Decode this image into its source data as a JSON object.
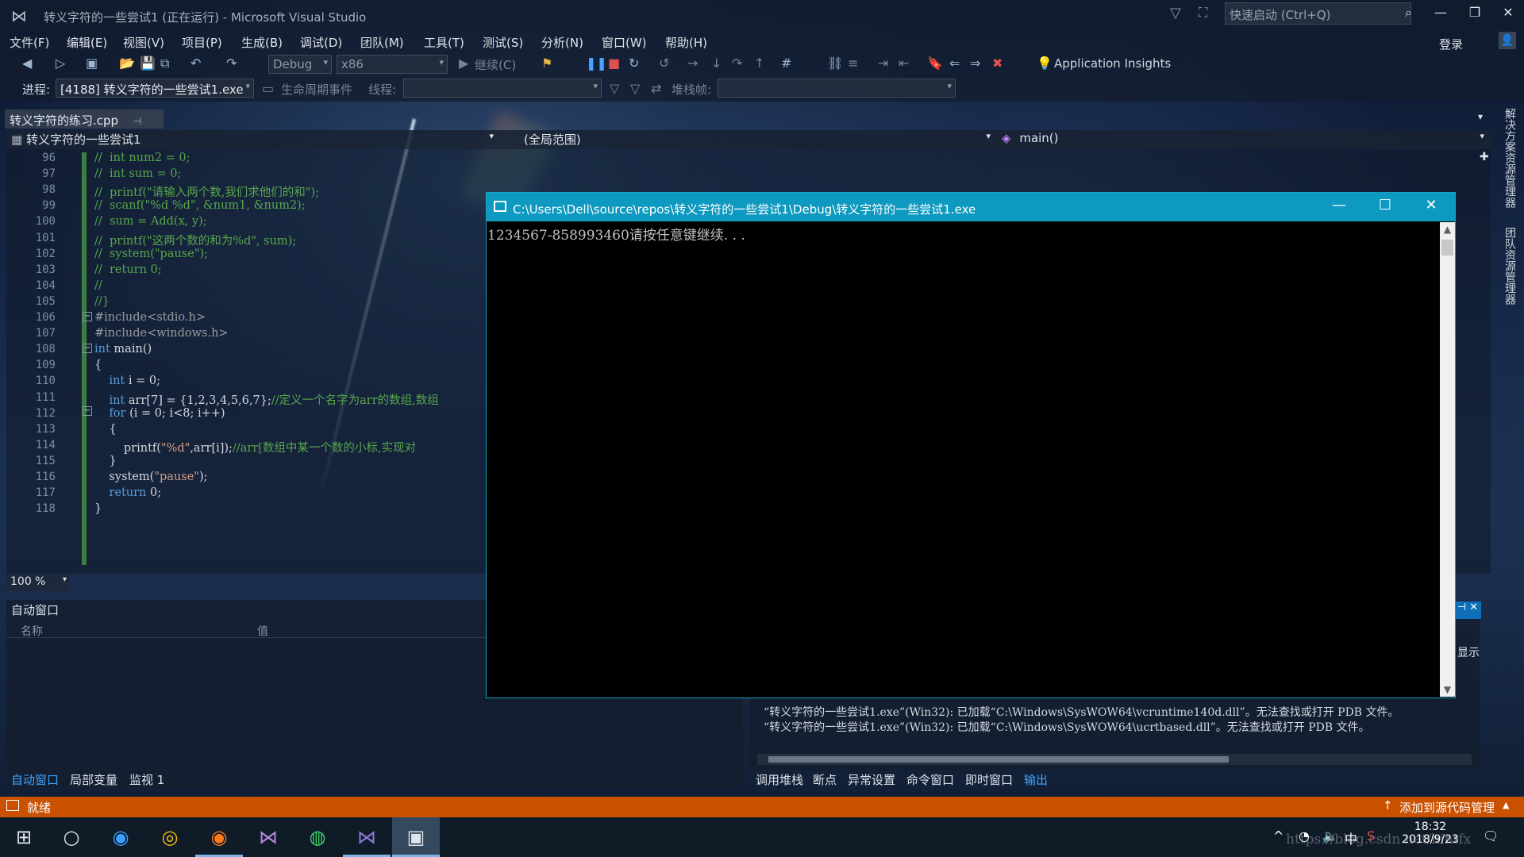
{
  "window": {
    "title": "转义字符的一些尝试1 (正在运行) - Microsoft Visual Studio",
    "quick_launch_placeholder": "快速启动 (Ctrl+Q)",
    "login": "登录"
  },
  "menu": [
    "文件(F)",
    "编辑(E)",
    "视图(V)",
    "项目(P)",
    "生成(B)",
    "调试(D)",
    "团队(M)",
    "工具(T)",
    "测试(S)",
    "分析(N)",
    "窗口(W)",
    "帮助(H)"
  ],
  "toolbar": {
    "config": "Debug",
    "platform": "x86",
    "continue_label": "继续(C)",
    "app_insights": "Application Insights"
  },
  "debug_bar": {
    "process_label": "进程:",
    "process_value": "[4188] 转义字符的一些尝试1.exe",
    "lifecycle_label": "生命周期事件",
    "thread_label": "线程:",
    "stack_label": "堆栈帧:"
  },
  "editor": {
    "tab_name": "转义字符的练习.cpp",
    "project_scope": "转义字符的一些尝试1",
    "global_scope": "(全局范围)",
    "function_scope": "main()",
    "zoom": "100 %",
    "lines": [
      {
        "n": "96",
        "text": "//  int num2 = 0;"
      },
      {
        "n": "97",
        "text": "//  int sum = 0;"
      },
      {
        "n": "98",
        "text": "//  printf(\"请输入两个数,我们求他们的和\");"
      },
      {
        "n": "99",
        "text": "//  scanf(\"%d %d\", &num1, &num2);"
      },
      {
        "n": "100",
        "text": "//  sum = Add(x, y);"
      },
      {
        "n": "101",
        "text": "//  printf(\"这两个数的和为%d\", sum);"
      },
      {
        "n": "102",
        "text": "//  system(\"pause\");"
      },
      {
        "n": "103",
        "text": "//  return 0;"
      },
      {
        "n": "104",
        "text": "//"
      },
      {
        "n": "105",
        "text": "//}"
      },
      {
        "n": "106",
        "text": "#include<stdio.h>"
      },
      {
        "n": "107",
        "text": "#include<windows.h>"
      },
      {
        "n": "108",
        "text": "int main()"
      },
      {
        "n": "109",
        "text": "{"
      },
      {
        "n": "110",
        "text": "    int i = 0;"
      },
      {
        "n": "111",
        "text": "    int arr[7] = {1,2,3,4,5,6,7};//定义一个名字为arr的数组,数组"
      },
      {
        "n": "112",
        "text": "    for (i = 0; i<8; i++)"
      },
      {
        "n": "113",
        "text": "    {"
      },
      {
        "n": "114",
        "text": "        printf(\"%d\",arr[i]);//arr[数组中某一个数的小标,实现对"
      },
      {
        "n": "115",
        "text": "    }"
      },
      {
        "n": "116",
        "text": "    system(\"pause\");"
      },
      {
        "n": "117",
        "text": "    return 0;"
      },
      {
        "n": "118",
        "text": "}"
      }
    ]
  },
  "console": {
    "title": "C:\\Users\\Dell\\source\\repos\\转义字符的一些尝试1\\Debug\\转义字符的一些尝试1.exe",
    "output": "1234567-858993460请按任意键继续. . ."
  },
  "autos": {
    "title": "自动窗口",
    "col_name": "名称",
    "col_value": "值",
    "tabs": [
      "自动窗口",
      "局部变量",
      "监视 1"
    ]
  },
  "output": {
    "partial_label": "显示",
    "lines": [
      "“转义字符的一些尝试1.exe”(Win32): 已加载“C:\\Windows\\SysWOW64\\vcruntime140d.dll”。无法查找或打开 PDB 文件。",
      "“转义字符的一些尝试1.exe”(Win32): 已加载“C:\\Windows\\SysWOW64\\ucrtbased.dll”。无法查找或打开 PDB 文件。"
    ],
    "tabs": [
      "调用堆栈",
      "断点",
      "异常设置",
      "命令窗口",
      "即时窗口",
      "输出"
    ]
  },
  "side_panels": [
    "解决方案资源管理器",
    "团队资源管理器"
  ],
  "status": {
    "left": "就绪",
    "right": "添加到源代码管理"
  },
  "taskbar": {
    "time": "18:32",
    "date": "2018/9/23",
    "ime": "中",
    "watermark": "https://blog.csdn.net/hintfx"
  }
}
